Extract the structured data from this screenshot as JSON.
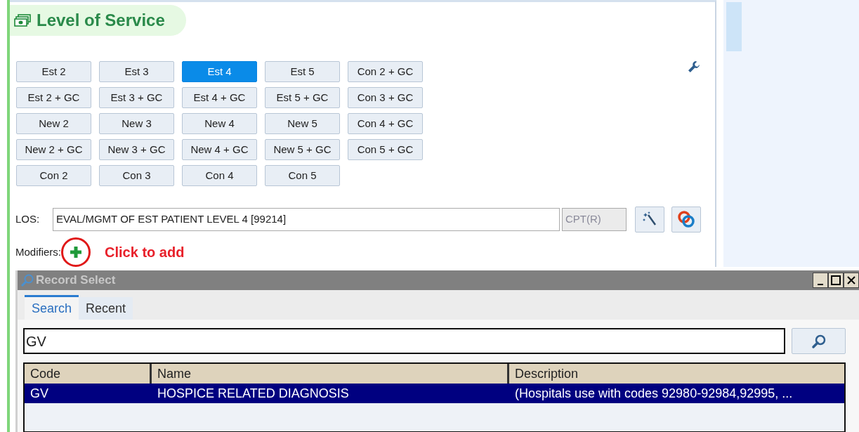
{
  "section": {
    "title": "Level of Service"
  },
  "code_buttons": [
    [
      {
        "label": "Est 2",
        "selected": false
      },
      {
        "label": "Est 3",
        "selected": false
      },
      {
        "label": "Est 4",
        "selected": true
      },
      {
        "label": "Est 5",
        "selected": false
      },
      {
        "label": "Con 2 + GC",
        "selected": false
      }
    ],
    [
      {
        "label": "Est 2 + GC",
        "selected": false
      },
      {
        "label": "Est 3 + GC",
        "selected": false
      },
      {
        "label": "Est 4 + GC",
        "selected": false
      },
      {
        "label": "Est 5 + GC",
        "selected": false
      },
      {
        "label": "Con 3 + GC",
        "selected": false
      }
    ],
    [
      {
        "label": "New 2",
        "selected": false
      },
      {
        "label": "New 3",
        "selected": false
      },
      {
        "label": "New 4",
        "selected": false
      },
      {
        "label": "New 5",
        "selected": false
      },
      {
        "label": "Con 4 + GC",
        "selected": false
      }
    ],
    [
      {
        "label": "New 2 + GC",
        "selected": false
      },
      {
        "label": "New 3 + GC",
        "selected": false
      },
      {
        "label": "New 4 + GC",
        "selected": false
      },
      {
        "label": "New 5 + GC",
        "selected": false
      },
      {
        "label": "Con 5 + GC",
        "selected": false
      }
    ],
    [
      {
        "label": "Con 2",
        "selected": false
      },
      {
        "label": "Con 3",
        "selected": false
      },
      {
        "label": "Con 4",
        "selected": false
      },
      {
        "label": "Con 5",
        "selected": false
      }
    ]
  ],
  "los": {
    "label": "LOS:",
    "value": "EVAL/MGMT OF EST PATIENT LEVEL 4 [99214]",
    "code_system": "CPT(R)"
  },
  "modifiers": {
    "label": "Modifiers:",
    "annotation": "Click to add"
  },
  "dialog": {
    "title": "Record Select",
    "tabs": [
      {
        "label": "Search",
        "selected": true
      },
      {
        "label": "Recent",
        "selected": false
      }
    ],
    "search": {
      "value": "GV"
    },
    "table": {
      "columns": [
        "Code",
        "Name",
        "Description"
      ],
      "rows": [
        {
          "cells": [
            "GV",
            "HOSPICE RELATED DIAGNOSIS",
            "(Hospitals use with codes 92980-92984,92995, ..."
          ],
          "selected": true
        }
      ]
    }
  }
}
